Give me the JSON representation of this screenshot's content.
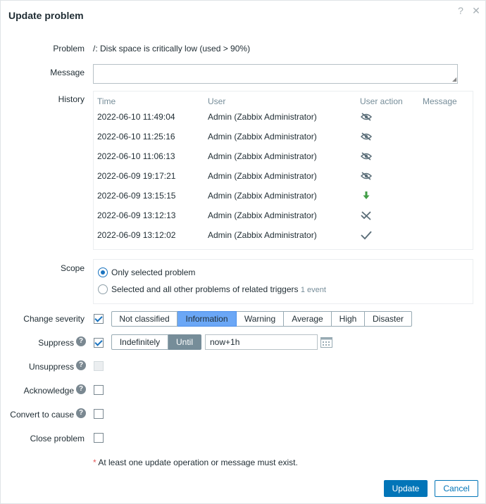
{
  "dialog": {
    "title": "Update problem",
    "help_icon": "?",
    "close_icon": "✕"
  },
  "problem": {
    "label": "Problem",
    "value": "/: Disk space is critically low (used > 90%)"
  },
  "message": {
    "label": "Message",
    "value": ""
  },
  "history": {
    "label": "History",
    "columns": [
      "Time",
      "User",
      "User action",
      "Message"
    ],
    "rows": [
      {
        "time": "2022-06-10 11:49:04",
        "user": "Admin (Zabbix Administrator)",
        "action_icon": "eye-hidden-icon",
        "message": ""
      },
      {
        "time": "2022-06-10 11:25:16",
        "user": "Admin (Zabbix Administrator)",
        "action_icon": "eye-hidden-icon",
        "message": ""
      },
      {
        "time": "2022-06-10 11:06:13",
        "user": "Admin (Zabbix Administrator)",
        "action_icon": "eye-hidden-icon",
        "message": ""
      },
      {
        "time": "2022-06-09 19:17:21",
        "user": "Admin (Zabbix Administrator)",
        "action_icon": "eye-hidden-icon",
        "message": ""
      },
      {
        "time": "2022-06-09 13:15:15",
        "user": "Admin (Zabbix Administrator)",
        "action_icon": "arrow-down-icon",
        "message": ""
      },
      {
        "time": "2022-06-09 13:12:13",
        "user": "Admin (Zabbix Administrator)",
        "action_icon": "unacknowledge-icon",
        "message": ""
      },
      {
        "time": "2022-06-09 13:12:02",
        "user": "Admin (Zabbix Administrator)",
        "action_icon": "checkmark-icon",
        "message": ""
      }
    ]
  },
  "scope": {
    "label": "Scope",
    "options": [
      {
        "label": "Only selected problem",
        "selected": true,
        "note": ""
      },
      {
        "label": "Selected and all other problems of related triggers",
        "selected": false,
        "note": "1 event"
      }
    ]
  },
  "change_severity": {
    "label": "Change severity",
    "checked": true,
    "options": [
      "Not classified",
      "Information",
      "Warning",
      "Average",
      "High",
      "Disaster"
    ],
    "selected": "Information",
    "selected_color": "#6ba7f6"
  },
  "suppress": {
    "label": "Suppress",
    "help_icon": "?",
    "checked": true,
    "options": [
      "Indefinitely",
      "Until"
    ],
    "selected": "Until",
    "until_value": "now+1h"
  },
  "unsuppress": {
    "label": "Unsuppress",
    "help_icon": "?",
    "checked": false,
    "disabled": true
  },
  "acknowledge": {
    "label": "Acknowledge",
    "help_icon": "?",
    "checked": false
  },
  "convert_to_cause": {
    "label": "Convert to cause",
    "help_icon": "?",
    "checked": false
  },
  "close_problem": {
    "label": "Close problem",
    "checked": false
  },
  "required_note": {
    "star": "*",
    "text": "At least one update operation or message must exist."
  },
  "footer": {
    "update_label": "Update",
    "cancel_label": "Cancel"
  },
  "colors": {
    "primary": "#0275b8",
    "muted": "#768d99",
    "required": "#e45959"
  }
}
